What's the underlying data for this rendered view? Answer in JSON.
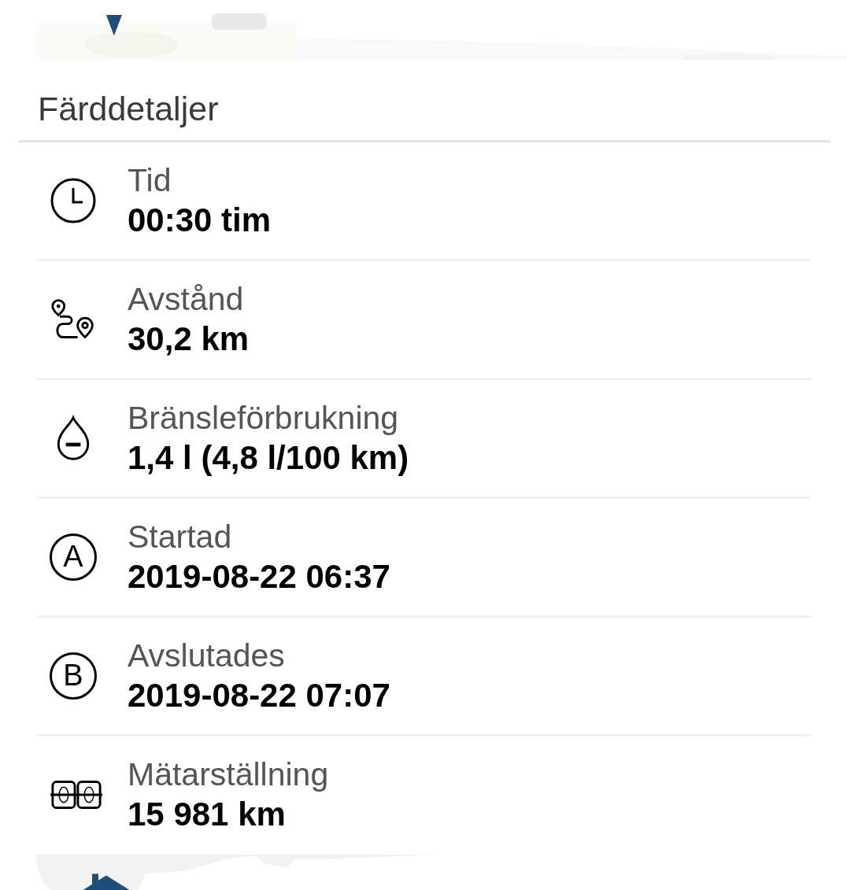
{
  "header": {
    "title": "Färddetaljer"
  },
  "details": [
    {
      "kind": "clock",
      "label": "Tid",
      "value": "00:30 tim"
    },
    {
      "kind": "route",
      "label": "Avstånd",
      "value": "30,2 km"
    },
    {
      "kind": "drop",
      "label": "Bränsleförbrukning",
      "value": "1,4 l (4,8 l/100 km)"
    },
    {
      "kind": "letter",
      "marker": "A",
      "label": "Startad",
      "value": "2019-08-22 06:37"
    },
    {
      "kind": "letter",
      "marker": "B",
      "label": "Avslutades",
      "value": "2019-08-22 07:07"
    },
    {
      "kind": "odometer",
      "label": "Mätarställning",
      "value": "15 981 km"
    }
  ]
}
